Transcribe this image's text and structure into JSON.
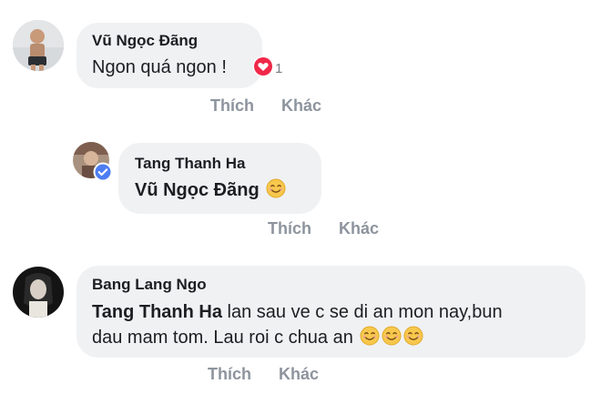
{
  "comments": [
    {
      "author": "Vũ Ngọc Đãng",
      "text": "Ngon quá ngon !",
      "reaction": {
        "icon": "heart-icon",
        "count": "1",
        "color": "#f0284a"
      },
      "actions": {
        "like": "Thích",
        "more": "Khác"
      }
    },
    {
      "author": "Tang Thanh Ha",
      "tag": "Vũ Ngọc Đãng",
      "emoji": "smiling-face-icon",
      "verified": true,
      "actions": {
        "like": "Thích",
        "more": "Khác"
      }
    },
    {
      "author": "Bang Lang Ngo",
      "tag": "Tang Thanh Ha",
      "line1": "lan sau ve c se di an mon nay,bun",
      "line2": "dau mam tom. Lau roi c chua an",
      "emoji_count": 3,
      "actions": {
        "like": "Thích",
        "more": "Khác"
      }
    }
  ],
  "colors": {
    "bubble": "#f0f1f3",
    "action_text": "#8d949e",
    "verified_badge": "#4c7df3"
  }
}
